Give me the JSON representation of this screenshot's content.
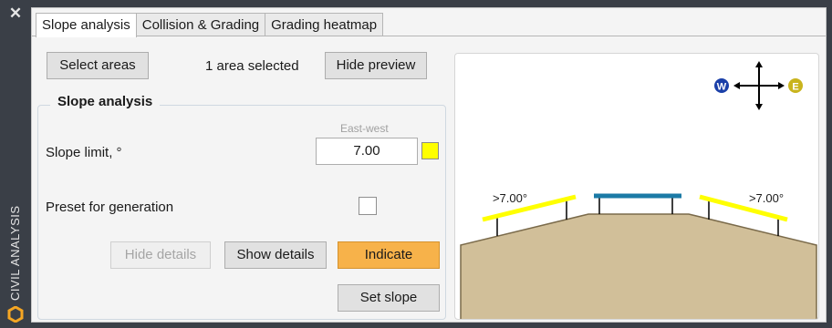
{
  "sidebar": {
    "close_icon": "close-icon",
    "title": "CIVIL ANALYSIS",
    "logo_icon": "app-logo-icon"
  },
  "tabs": [
    {
      "label": "Slope analysis",
      "active": true
    },
    {
      "label": "Collision & Grading",
      "active": false
    },
    {
      "label": "Grading heatmap",
      "active": false
    }
  ],
  "toolbar": {
    "select_areas_label": "Select areas",
    "selection_status": "1 area selected",
    "hide_preview_label": "Hide preview"
  },
  "slope_group": {
    "title": "Slope analysis",
    "column_header": "East-west",
    "slope_limit_label": "Slope limit, °",
    "slope_limit_value": "7.00",
    "slope_color": "#ffff00",
    "preset_label": "Preset for generation",
    "preset_checked": false
  },
  "actions": {
    "hide_details_label": "Hide details",
    "show_details_label": "Show details",
    "indicate_label": "Indicate",
    "set_slope_label": "Set slope"
  },
  "preview": {
    "west_label": "W",
    "east_label": "E",
    "left_slope_label": ">7.00°",
    "right_slope_label": ">7.00°",
    "terrain_color": "#d1bf99",
    "flat_color": "#1b7aa6",
    "slope_color": "#ffff00",
    "west_color": "#1a3fa8",
    "east_color": "#c9b41d"
  }
}
